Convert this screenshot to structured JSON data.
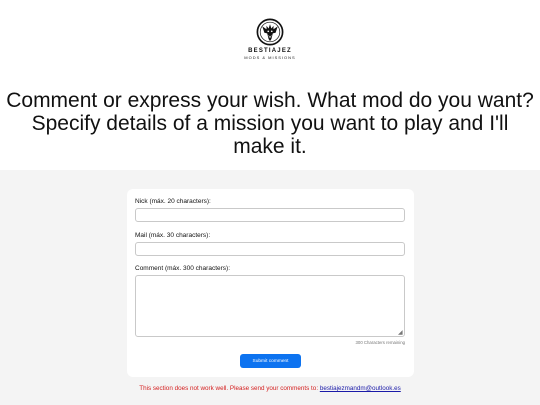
{
  "logo": {
    "name": "BESTIAJEZ",
    "tagline": "MODS & MISSIONS"
  },
  "headline": "Comment or express your wish. What mod do you want? Specify details of a mission you want to play and I'll make it.",
  "form": {
    "nick_label": "Nick (máx. 20 characters):",
    "mail_label": "Mail (máx. 30 characters):",
    "comment_label": "Comment (máx. 300 characters):",
    "nick_value": "",
    "mail_value": "",
    "comment_value": "",
    "remaining_text": "300 Characters remaining",
    "submit_label": "Submit comment"
  },
  "notice": {
    "text": "This section does not work well. Please send your comments to: ",
    "email": "bestiajezmandm@outlook.es"
  },
  "colors": {
    "accent": "#0d73f0",
    "notice": "#d41e1e",
    "link": "#1a1aa8",
    "background_panel": "#f4f4f4"
  }
}
